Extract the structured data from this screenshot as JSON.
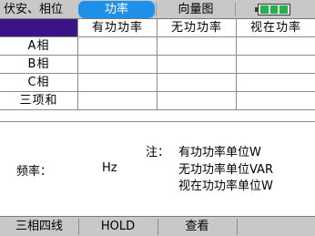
{
  "tabs": [
    {
      "label": "伏安、相位"
    },
    {
      "label": "功率",
      "active": true
    },
    {
      "label": "向量图"
    },
    {
      "label": ""
    }
  ],
  "battery": {
    "level_fraction": 1.0,
    "color": "#22b14c"
  },
  "table": {
    "columns": [
      "",
      "有功功率",
      "无功功率",
      "视在功率"
    ],
    "rows": [
      {
        "label": "A相",
        "values": [
          "",
          "",
          ""
        ]
      },
      {
        "label": "B相",
        "values": [
          "",
          "",
          ""
        ]
      },
      {
        "label": "C相",
        "values": [
          "",
          "",
          ""
        ]
      },
      {
        "label": "三项和",
        "values": [
          "",
          "",
          ""
        ]
      }
    ]
  },
  "frequency": {
    "label": "频率：",
    "unit": "Hz"
  },
  "notes": {
    "prefix": "注：",
    "lines": [
      "有功功率单位W",
      "无功功率单位VAR",
      "视在功功率单位W"
    ]
  },
  "softkeys": [
    {
      "label": "三相四线"
    },
    {
      "label": "HOLD"
    },
    {
      "label": "查看"
    },
    {
      "label": ""
    }
  ],
  "colors": {
    "accent_tab": "#1e90e8",
    "header_cell": "#3a1485",
    "bar_bg": "#c8c8c8"
  }
}
